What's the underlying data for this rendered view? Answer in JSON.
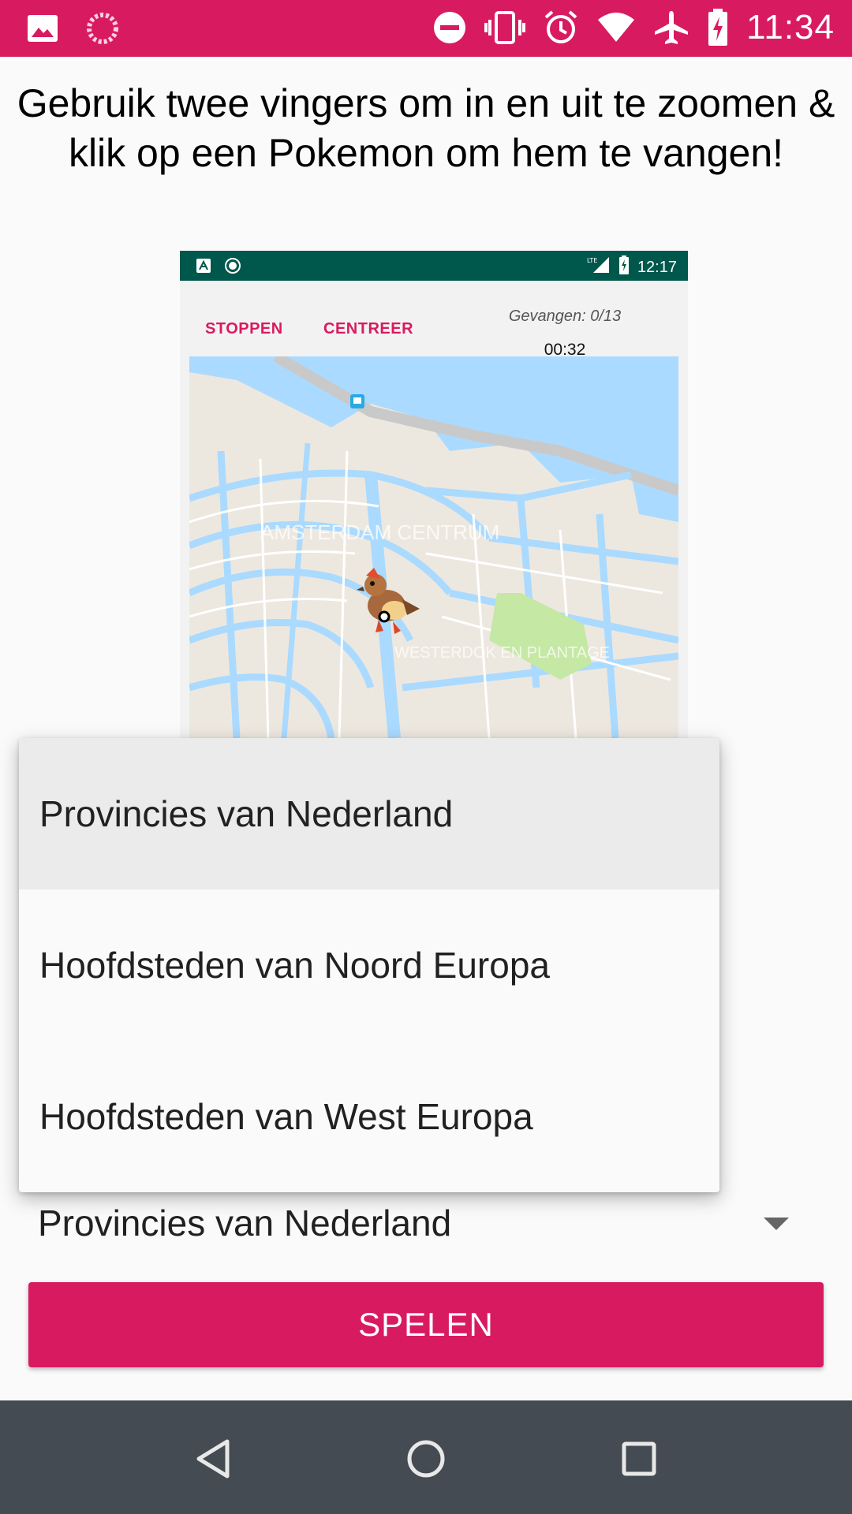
{
  "status_bar": {
    "time": "11:34",
    "left_icons": [
      "image-notification-icon",
      "loading-spinner-icon"
    ],
    "right_icons": [
      "do-not-disturb-icon",
      "vibrate-icon",
      "alarm-icon",
      "wifi-icon",
      "airplane-mode-icon",
      "battery-charging-icon"
    ]
  },
  "instruction": "Gebruik twee vingers om in en uit te zoomen & klik op een Pokemon om hem te vangen!",
  "preview": {
    "status_bar": {
      "time": "12:17",
      "network": "LTE"
    },
    "toolbar": {
      "stop_label": "STOPPEN",
      "center_label": "CENTREER",
      "caught": "Gevangen: 0/13",
      "timer": "00:32"
    },
    "map": {
      "labels": [
        "AMSTERDAM CENTRUM",
        "WESTERDOK EN PLANTAGE"
      ],
      "water_color": "#aadaff",
      "land_color": "#ede8df",
      "park_color": "#c5e8a5"
    }
  },
  "dropdown": {
    "options": [
      "Provincies van Nederland",
      "Hoofdsteden van Noord Europa",
      "Hoofdsteden van West Europa"
    ],
    "selected_index": 0
  },
  "spinner": {
    "value": "Provincies van Nederland"
  },
  "play_button": {
    "label": "SPELEN"
  },
  "colors": {
    "accent": "#d81b60",
    "preview_status": "#00574b",
    "nav_bar": "#444b52"
  }
}
